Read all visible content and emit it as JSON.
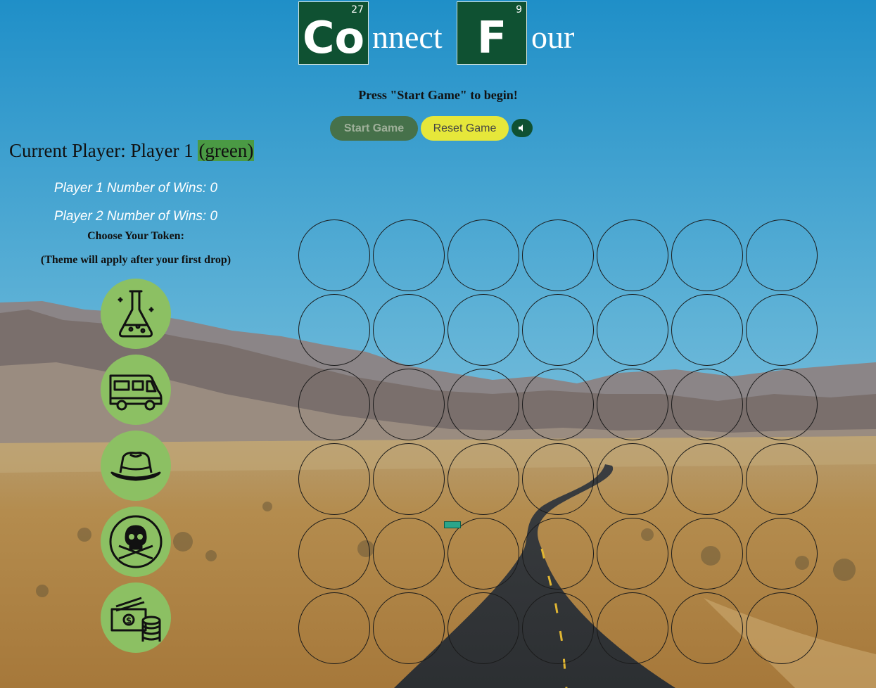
{
  "title": {
    "tile1": {
      "number": "27",
      "symbol": "Co"
    },
    "text1": "nnect",
    "tile2": {
      "number": "9",
      "symbol": "F"
    },
    "text2": "our"
  },
  "message": "Press \"Start Game\" to begin!",
  "buttons": {
    "start": "Start Game",
    "reset": "Reset Game",
    "sound_icon": "sound-icon"
  },
  "current_player": {
    "label": "Current Player: Player 1 ",
    "color_label": "(green)"
  },
  "wins": {
    "player1": "Player 1 Number of Wins: 0",
    "player2": "Player 2 Number of Wins: 0"
  },
  "token_chooser": {
    "heading": "Choose Your Token:",
    "note": "(Theme will apply after your first drop)",
    "tokens": [
      "flask-icon",
      "rv-camper-icon",
      "fedora-hat-icon",
      "skull-crossbones-icon",
      "money-icon"
    ]
  },
  "board": {
    "rows": 6,
    "columns": 7
  },
  "colors": {
    "tile_green": "#0f5132",
    "player1_highlight": "#4a9a44",
    "token_background": "#8cc063",
    "start_button": "#46714a",
    "reset_button": "#e6e73a"
  }
}
